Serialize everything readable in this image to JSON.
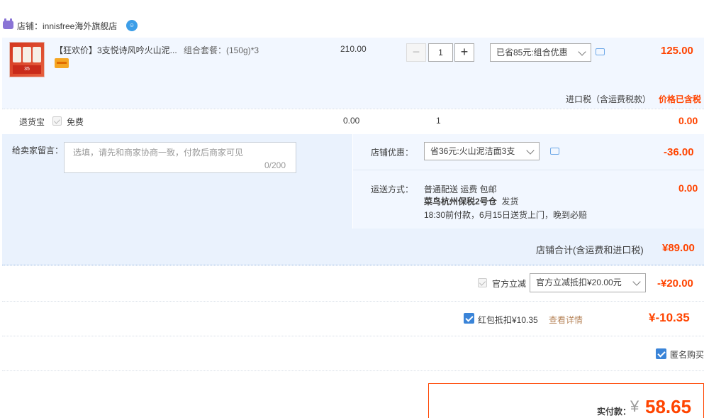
{
  "shop": {
    "label": "店铺：innisfree海外旗舰店",
    "wangwang_icon": "wangwang-chat-icon"
  },
  "item": {
    "title": "【狂欢价】3支悦诗风吟火山泥...",
    "sku": "组合套餐：(150g)*3",
    "unit_price": "210.00",
    "qty_minus": "−",
    "quantity": "1",
    "qty_plus": "+",
    "promo_selected": "已省85元:组合优惠",
    "total": "125.00",
    "tax_label": "进口税（含运费税款）",
    "tax_value": "价格已含税"
  },
  "return_insurance": {
    "label": "退货宝",
    "free": "免费",
    "price": "0.00",
    "qty": "1",
    "total": "0.00"
  },
  "message": {
    "label": "给卖家留言：",
    "placeholder": "选填，请先和商家协商一致，付款后商家可见",
    "count": "0/200"
  },
  "shop_promo": {
    "label": "店铺优惠：",
    "selected": "省36元:火山泥洁面3支",
    "total": "-36.00"
  },
  "shipping": {
    "label": "运送方式：",
    "line1": "普通配送 运费 包邮",
    "warehouse": "菜鸟杭州保税2号仓",
    "ship_suffix": "发货",
    "line3": "18:30前付款，6月15日送货上门，晚到必赔",
    "total": "0.00"
  },
  "subtotal": {
    "label": "店铺合计(含运费和进口税)",
    "value": "¥89.00"
  },
  "official_discount": {
    "label": "官方立减",
    "selected": "官方立减抵扣¥20.00元",
    "total": "-¥20.00"
  },
  "red_packet": {
    "label": "红包抵扣¥10.35",
    "link": "查看详情",
    "total": "¥-10.35"
  },
  "anonymous": {
    "label": "匿名购买"
  },
  "payment": {
    "label": "实付款：",
    "currency": "¥",
    "value": "58.65"
  },
  "colors": {
    "accent_red": "#ff4400",
    "checkbox_blue": "#3a84d8",
    "panel_blue": "#eaf2fd"
  }
}
